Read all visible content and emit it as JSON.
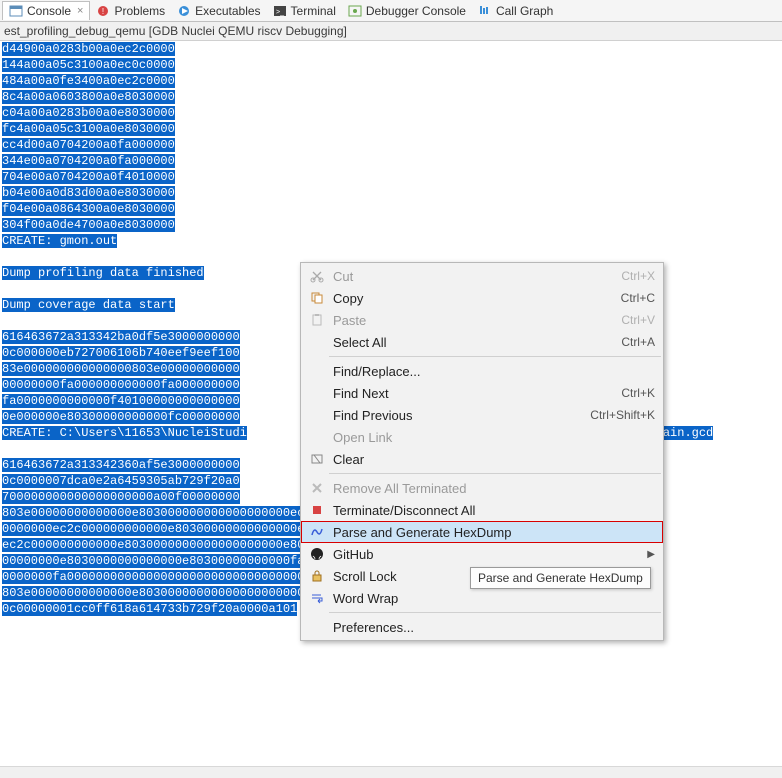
{
  "tabs": [
    {
      "label": "Console",
      "active": true,
      "icon": "console-icon"
    },
    {
      "label": "Problems",
      "icon": "problems-icon"
    },
    {
      "label": "Executables",
      "icon": "executables-icon"
    },
    {
      "label": "Terminal",
      "icon": "terminal-icon"
    },
    {
      "label": "Debugger Console",
      "icon": "debugger-console-icon"
    },
    {
      "label": "Call Graph",
      "icon": "call-graph-icon"
    }
  ],
  "session": "est_profiling_debug_qemu [GDB Nuclei QEMU riscv Debugging]",
  "console": {
    "block1": [
      "d44900a0283b00a0ec2c0000",
      "144a00a05c3100a0ec0c0000",
      "484a00a0fe3400a0ec2c0000",
      "8c4a00a0603800a0e8030000",
      "c04a00a0283b00a0e8030000",
      "fc4a00a05c3100a0e8030000",
      "cc4d00a0704200a0fa000000",
      "344e00a0704200a0fa000000",
      "704e00a0704200a0f4010000",
      "b04e00a0d83d00a0e8030000",
      "f04e00a0864300a0e8030000",
      "304f00a0de4700a0e8030000"
    ],
    "create1": "CREATE: gmon.out",
    "dump1": "Dump profiling data finished",
    "dump2": "Dump coverage data start",
    "block2": [
      "616463672a313342ba0df5e3000000000",
      "0c000000eb727006106b740eef9eef100",
      "83e000000000000000803e00000000000",
      "00000000fa000000000000fa000000000",
      "fa0000000000000f40100000000000000",
      "0e000000e80300000000000fc00000000"
    ],
    "create2": "CREATE: C:\\Users\\11653\\NucleiStudi",
    "create2_suffix": "ion/main.gcd",
    "block3": [
      "616463672a313342360af5e3000000000",
      "0c0000007dca0e2a6459305ab729f20a0",
      "700000000000000000000a00f00000000",
      "803e00000000000000e803000000000000000000ec2c0000",
      "0000000ec2c000000000000e80300000000000000ec2c000000000000",
      "ec2c000000000000e8030000000000000000000e8030000",
      "00000000e8030000000000000e80300000000000fa000000",
      "0000000fa0000000000000000000000000000000000000000",
      "803e00000000000000e8030000000000000000000000000000",
      "0c00000001cc0ff618a614733b729f20a0000a101"
    ]
  },
  "menu": {
    "cut": "Cut",
    "cut_sc": "Ctrl+X",
    "copy": "Copy",
    "copy_sc": "Ctrl+C",
    "paste": "Paste",
    "paste_sc": "Ctrl+V",
    "select_all": "Select All",
    "select_all_sc": "Ctrl+A",
    "find_replace": "Find/Replace...",
    "find_next": "Find Next",
    "find_next_sc": "Ctrl+K",
    "find_prev": "Find Previous",
    "find_prev_sc": "Ctrl+Shift+K",
    "open_link": "Open Link",
    "clear": "Clear",
    "remove_all_terminated": "Remove All Terminated",
    "terminate_disconnect": "Terminate/Disconnect All",
    "parse_hexdump": "Parse and Generate HexDump",
    "github": "GitHub",
    "scroll_lock": "Scroll Lock",
    "word_wrap": "Word Wrap",
    "preferences": "Preferences..."
  },
  "tooltip": "Parse and Generate HexDump"
}
